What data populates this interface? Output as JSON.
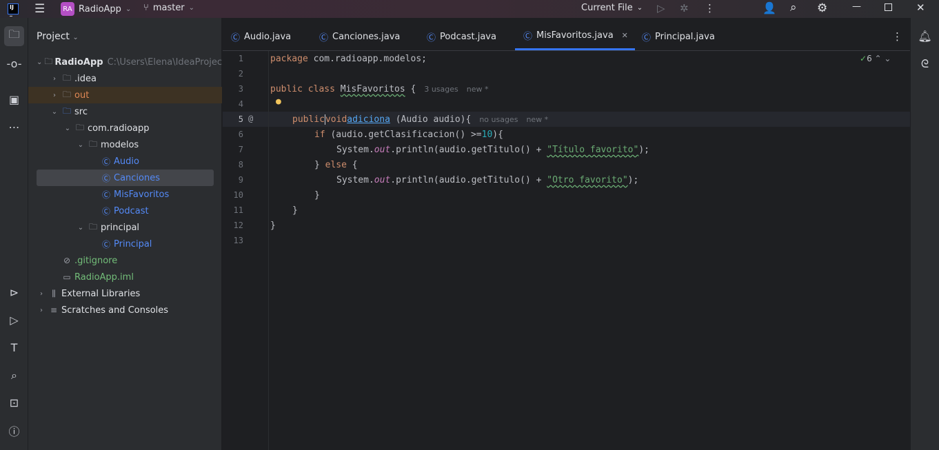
{
  "titlebar": {
    "logo": "IJ",
    "project_badge": "RA",
    "project": "RadioApp",
    "branch": "master",
    "run_config": "Current File"
  },
  "project_panel": {
    "title": "Project",
    "tree": [
      {
        "label": "RadioApp",
        "extra": "C:\\Users\\Elena\\IdeaProjec",
        "depth": 0,
        "expanded": true,
        "icon": "module-folder-icon",
        "bold": true
      },
      {
        "label": ".idea",
        "depth": 1,
        "expanded": false,
        "icon": "folder-icon"
      },
      {
        "label": "out",
        "depth": 1,
        "expanded": false,
        "icon": "folder-icon",
        "color": "#e08855"
      },
      {
        "label": "src",
        "depth": 1,
        "expanded": true,
        "icon": "source-folder-icon"
      },
      {
        "label": "com.radioapp",
        "depth": 2,
        "expanded": true,
        "icon": "package-icon"
      },
      {
        "label": "modelos",
        "depth": 3,
        "expanded": true,
        "icon": "package-icon"
      },
      {
        "label": "Audio",
        "depth": 4,
        "icon": "class-icon",
        "color": "#548af7"
      },
      {
        "label": "Canciones",
        "depth": 4,
        "icon": "class-icon",
        "color": "#548af7",
        "selected": true
      },
      {
        "label": "MisFavoritos",
        "depth": 4,
        "icon": "class-icon",
        "color": "#548af7"
      },
      {
        "label": "Podcast",
        "depth": 4,
        "icon": "class-icon",
        "color": "#548af7"
      },
      {
        "label": "principal",
        "depth": 3,
        "expanded": true,
        "icon": "package-icon"
      },
      {
        "label": "Principal",
        "depth": 4,
        "icon": "main-class-icon",
        "color": "#548af7"
      },
      {
        "label": ".gitignore",
        "depth": 1,
        "icon": "ignore-file-icon",
        "color": "#73bd79"
      },
      {
        "label": "RadioApp.iml",
        "depth": 1,
        "icon": "iml-file-icon",
        "color": "#73bd79"
      },
      {
        "label": "External Libraries",
        "depth": 0,
        "expanded": false,
        "icon": "library-icon"
      },
      {
        "label": "Scratches and Consoles",
        "depth": 0,
        "expanded": false,
        "icon": "scratches-icon"
      }
    ]
  },
  "tabs": [
    {
      "label": "Audio.java"
    },
    {
      "label": "Canciones.java"
    },
    {
      "label": "Podcast.java"
    },
    {
      "label": "MisFavoritos.java",
      "active": true
    },
    {
      "label": "Principal.java"
    }
  ],
  "editor": {
    "inspections": "6",
    "lines": [
      "1",
      "2",
      "3",
      "4",
      "5",
      "6",
      "7",
      "8",
      "9",
      "10",
      "11",
      "12",
      "13"
    ],
    "hints": {
      "class_usages": "3 usages",
      "class_new": "new *",
      "method_usages": "no usages",
      "method_new": "new *"
    },
    "code": {
      "pkg_kw": "package",
      "pkg_name": " com.radioapp.modelos;",
      "pub": "public",
      "cls": " class ",
      "cls_name": "MisFavoritos",
      " brace": " {",
      "void": "void",
      "method": "adiciona",
      "params": " (Audio audio){",
      "if": "if",
      "cond": " (audio.getClasificacion() >=",
      "ten": "10",
      "cond_end": "){",
      "sys": "System.",
      "out": "out",
      "println": ".println(audio.getTitulo() + ",
      "s1": "\"Título favorito\"",
      "s2": "\"Otro favorito\"",
      "end": ");",
      "else_open": "} ",
      "else": "else",
      " else_brace": " {",
      "close": "}"
    }
  }
}
